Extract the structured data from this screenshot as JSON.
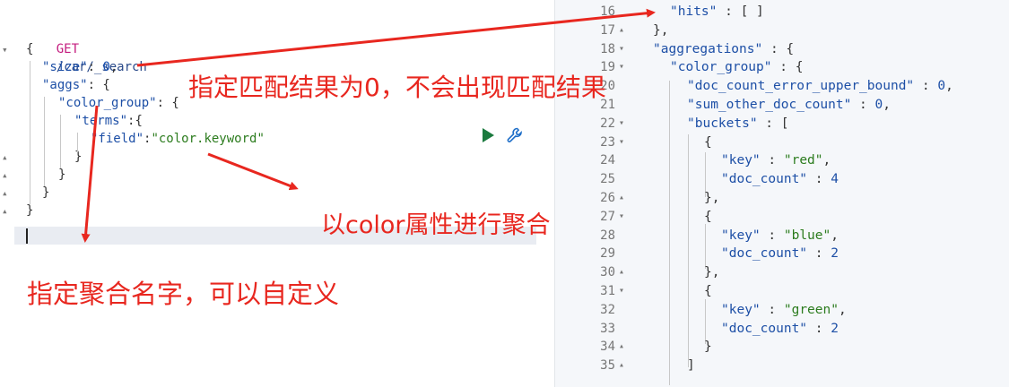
{
  "request": {
    "method": "GET",
    "url": "/car/_search",
    "lines": [
      {
        "indent": 0,
        "parts": [
          {
            "t": "{",
            "c": "punc"
          }
        ]
      },
      {
        "indent": 1,
        "parts": [
          {
            "t": "\"size\"",
            "c": "key"
          },
          {
            "t": ": ",
            "c": "punc"
          },
          {
            "t": "0",
            "c": "num"
          },
          {
            "t": ",",
            "c": "punc"
          }
        ]
      },
      {
        "indent": 1,
        "parts": [
          {
            "t": "\"aggs\"",
            "c": "key"
          },
          {
            "t": ": {",
            "c": "punc"
          }
        ]
      },
      {
        "indent": 2,
        "parts": [
          {
            "t": "\"color_group\"",
            "c": "key"
          },
          {
            "t": ": {",
            "c": "punc"
          }
        ]
      },
      {
        "indent": 3,
        "parts": [
          {
            "t": "\"terms\"",
            "c": "key"
          },
          {
            "t": ":{",
            "c": "punc"
          }
        ]
      },
      {
        "indent": 4,
        "parts": [
          {
            "t": "\"field\"",
            "c": "key"
          },
          {
            "t": ":",
            "c": "punc"
          },
          {
            "t": "\"color.keyword\"",
            "c": "str"
          }
        ]
      },
      {
        "indent": 3,
        "parts": [
          {
            "t": "}",
            "c": "punc"
          }
        ]
      },
      {
        "indent": 2,
        "parts": [
          {
            "t": "}",
            "c": "punc"
          }
        ]
      },
      {
        "indent": 1,
        "parts": [
          {
            "t": "}",
            "c": "punc"
          }
        ]
      },
      {
        "indent": 0,
        "parts": [
          {
            "t": "}",
            "c": "punc"
          }
        ]
      }
    ]
  },
  "response": {
    "lines": [
      {
        "num": "16",
        "fold": "",
        "indent": 1,
        "parts": [
          {
            "t": "\"hits\"",
            "c": "key"
          },
          {
            "t": " : [ ]",
            "c": "punc"
          }
        ]
      },
      {
        "num": "17",
        "fold": "up",
        "indent": 0,
        "parts": [
          {
            "t": "},",
            "c": "punc"
          }
        ]
      },
      {
        "num": "18",
        "fold": "down",
        "indent": 0,
        "parts": [
          {
            "t": "\"aggregations\"",
            "c": "key"
          },
          {
            "t": " : {",
            "c": "punc"
          }
        ]
      },
      {
        "num": "19",
        "fold": "down",
        "indent": 1,
        "parts": [
          {
            "t": "\"color_group\"",
            "c": "key"
          },
          {
            "t": " : {",
            "c": "punc"
          }
        ]
      },
      {
        "num": "20",
        "fold": "",
        "indent": 2,
        "parts": [
          {
            "t": "\"doc_count_error_upper_bound\"",
            "c": "key"
          },
          {
            "t": " : ",
            "c": "punc"
          },
          {
            "t": "0",
            "c": "num"
          },
          {
            "t": ",",
            "c": "punc"
          }
        ]
      },
      {
        "num": "21",
        "fold": "",
        "indent": 2,
        "parts": [
          {
            "t": "\"sum_other_doc_count\"",
            "c": "key"
          },
          {
            "t": " : ",
            "c": "punc"
          },
          {
            "t": "0",
            "c": "num"
          },
          {
            "t": ",",
            "c": "punc"
          }
        ]
      },
      {
        "num": "22",
        "fold": "down",
        "indent": 2,
        "parts": [
          {
            "t": "\"buckets\"",
            "c": "key"
          },
          {
            "t": " : [",
            "c": "punc"
          }
        ]
      },
      {
        "num": "23",
        "fold": "down",
        "indent": 3,
        "parts": [
          {
            "t": "{",
            "c": "punc"
          }
        ]
      },
      {
        "num": "24",
        "fold": "",
        "indent": 4,
        "parts": [
          {
            "t": "\"key\"",
            "c": "key"
          },
          {
            "t": " : ",
            "c": "punc"
          },
          {
            "t": "\"red\"",
            "c": "str"
          },
          {
            "t": ",",
            "c": "punc"
          }
        ]
      },
      {
        "num": "25",
        "fold": "",
        "indent": 4,
        "parts": [
          {
            "t": "\"doc_count\"",
            "c": "key"
          },
          {
            "t": " : ",
            "c": "punc"
          },
          {
            "t": "4",
            "c": "num"
          }
        ]
      },
      {
        "num": "26",
        "fold": "up",
        "indent": 3,
        "parts": [
          {
            "t": "},",
            "c": "punc"
          }
        ]
      },
      {
        "num": "27",
        "fold": "down",
        "indent": 3,
        "parts": [
          {
            "t": "{",
            "c": "punc"
          }
        ]
      },
      {
        "num": "28",
        "fold": "",
        "indent": 4,
        "parts": [
          {
            "t": "\"key\"",
            "c": "key"
          },
          {
            "t": " : ",
            "c": "punc"
          },
          {
            "t": "\"blue\"",
            "c": "str"
          },
          {
            "t": ",",
            "c": "punc"
          }
        ]
      },
      {
        "num": "29",
        "fold": "",
        "indent": 4,
        "parts": [
          {
            "t": "\"doc_count\"",
            "c": "key"
          },
          {
            "t": " : ",
            "c": "punc"
          },
          {
            "t": "2",
            "c": "num"
          }
        ]
      },
      {
        "num": "30",
        "fold": "up",
        "indent": 3,
        "parts": [
          {
            "t": "},",
            "c": "punc"
          }
        ]
      },
      {
        "num": "31",
        "fold": "down",
        "indent": 3,
        "parts": [
          {
            "t": "{",
            "c": "punc"
          }
        ]
      },
      {
        "num": "32",
        "fold": "",
        "indent": 4,
        "parts": [
          {
            "t": "\"key\"",
            "c": "key"
          },
          {
            "t": " : ",
            "c": "punc"
          },
          {
            "t": "\"green\"",
            "c": "str"
          },
          {
            "t": ",",
            "c": "punc"
          }
        ]
      },
      {
        "num": "33",
        "fold": "",
        "indent": 4,
        "parts": [
          {
            "t": "\"doc_count\"",
            "c": "key"
          },
          {
            "t": " : ",
            "c": "punc"
          },
          {
            "t": "2",
            "c": "num"
          }
        ]
      },
      {
        "num": "34",
        "fold": "up",
        "indent": 3,
        "parts": [
          {
            "t": "}",
            "c": "punc"
          }
        ]
      },
      {
        "num": "35",
        "fold": "up",
        "indent": 2,
        "parts": [
          {
            "t": "]",
            "c": "punc"
          }
        ]
      }
    ]
  },
  "annotations": {
    "size_note": "指定匹配结果为0，不会出现匹配结果",
    "field_note": "以color属性进行聚合",
    "name_note": "指定聚合名字，可以自定义"
  },
  "icons": {
    "run": "play-icon",
    "settings": "wrench-icon",
    "splitter": "vertical-dots-icon"
  },
  "colors": {
    "annotation": "#e8271f",
    "method": "#c41d7f",
    "key": "#1d4fa6",
    "string": "#2c7c1e",
    "run_button": "#1b7a3e"
  }
}
